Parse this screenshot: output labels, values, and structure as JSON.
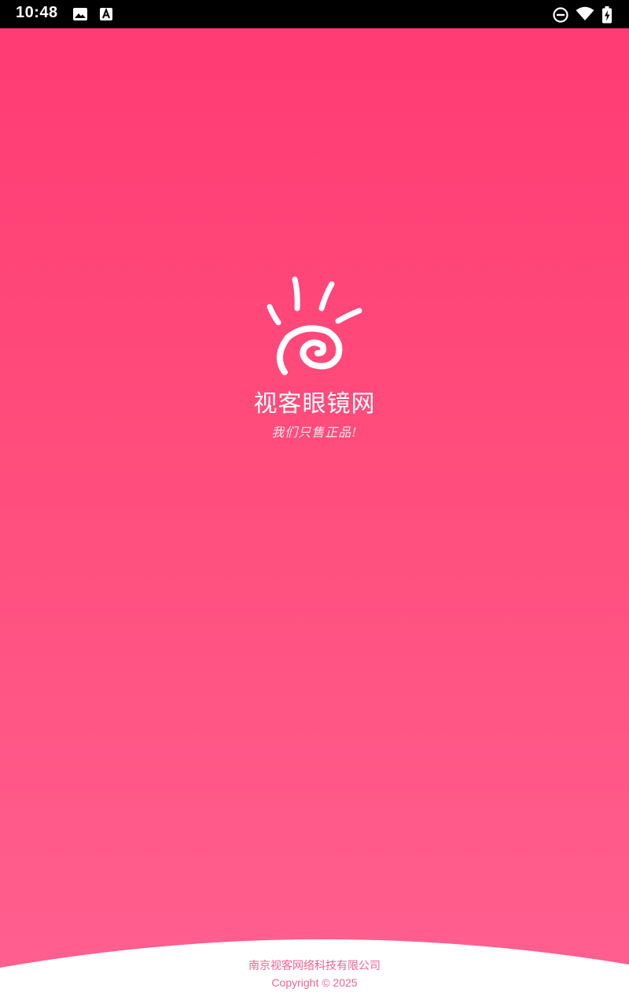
{
  "status_bar": {
    "time": "10:48",
    "icons": [
      "image-icon",
      "font-download-icon",
      "do-not-disturb-icon",
      "wifi-icon",
      "battery-charging-icon"
    ]
  },
  "splash": {
    "brand_name": "视客眼镜网",
    "slogan": "我们只售正品!",
    "logo_icon": "sun-swirl-logo-icon"
  },
  "footer": {
    "company_name": "南京视客网络科技有限公司",
    "copyright": "Copyright © 2025"
  },
  "colors": {
    "primary_top": "#ff3a73",
    "primary_bottom": "#ff6090",
    "footer_text": "#f0648e",
    "white": "#ffffff"
  }
}
